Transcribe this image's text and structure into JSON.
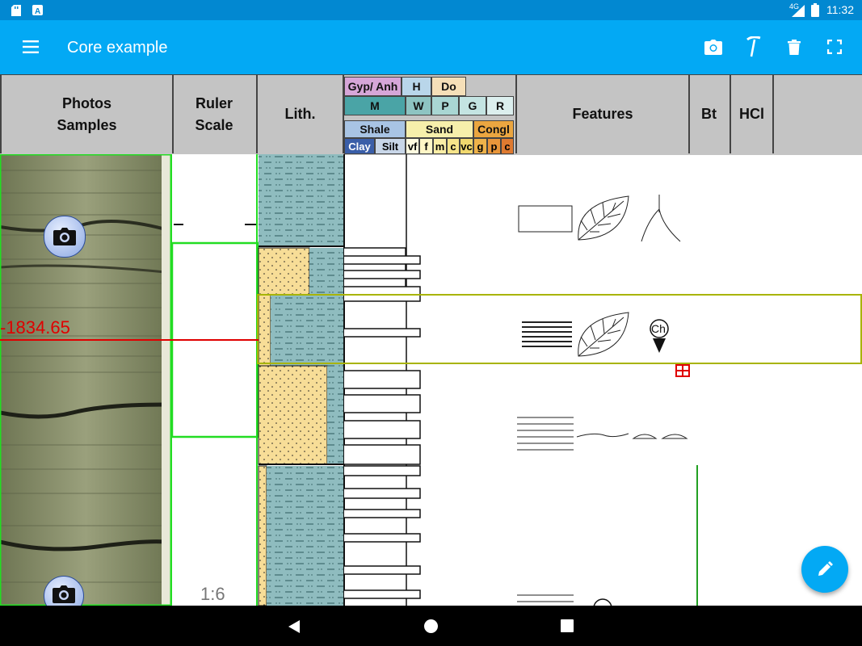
{
  "status_bar": {
    "time": "11:32",
    "network": "4G",
    "icons": [
      "sd-card-icon",
      "a-icon",
      "signal-icon",
      "battery-icon"
    ]
  },
  "app_bar": {
    "title": "Core example",
    "actions": [
      "camera-icon",
      "hammer-icon",
      "trash-icon",
      "fullscreen-icon"
    ],
    "menu_icon": "menu-icon"
  },
  "header": {
    "photos_samples": "Photos Samples",
    "photos_line1": "Photos",
    "photos_line2": "Samples",
    "ruler_line1": "Ruler",
    "ruler_line2": "Scale",
    "lith": "Lith.",
    "grain_top": [
      "Gyp/ Anh",
      "H",
      "Do"
    ],
    "grain_mid": [
      "M",
      "W",
      "P",
      "G",
      "R"
    ],
    "shale": "Shale",
    "sand": "Sand",
    "congl": "Congl",
    "sub": [
      "Clay",
      "Silt",
      "vf",
      "f",
      "m",
      "c",
      "vc",
      "g",
      "p",
      "c"
    ],
    "features": "Features",
    "bt": "Bt",
    "hcl": "HCl"
  },
  "log": {
    "depth_marker": "-1834.65",
    "scale_label": "1:6",
    "feature_symbol_label": "Ch"
  },
  "colors": {
    "status_bar": "#0288d1",
    "app_bar": "#03a9f4",
    "header": "#c4c4c4",
    "shale_fill": "#8fbcbf",
    "sand_fill": "#f7dd97",
    "gyp": "#d6a6d8",
    "h": "#b9d6ea",
    "do": "#f5dfb8",
    "m": "#4aa4a6",
    "w": "#8ec4c2",
    "p": "#a9d6d3",
    "g": "#c4e4e2",
    "r": "#dcefee",
    "shale_hdr": "#a8c4e4",
    "sand_hdr": "#f6efab",
    "congl_hdr": "#eba640",
    "clay_hdr": "#3a5ea8",
    "marker_red": "#e00000",
    "selection_green": "#22dd22",
    "highlight_olive": "#a8b400"
  },
  "fab": {
    "icon": "pencil-icon"
  },
  "nav_bar": {
    "buttons": [
      "back-icon",
      "home-icon",
      "recents-icon"
    ]
  }
}
